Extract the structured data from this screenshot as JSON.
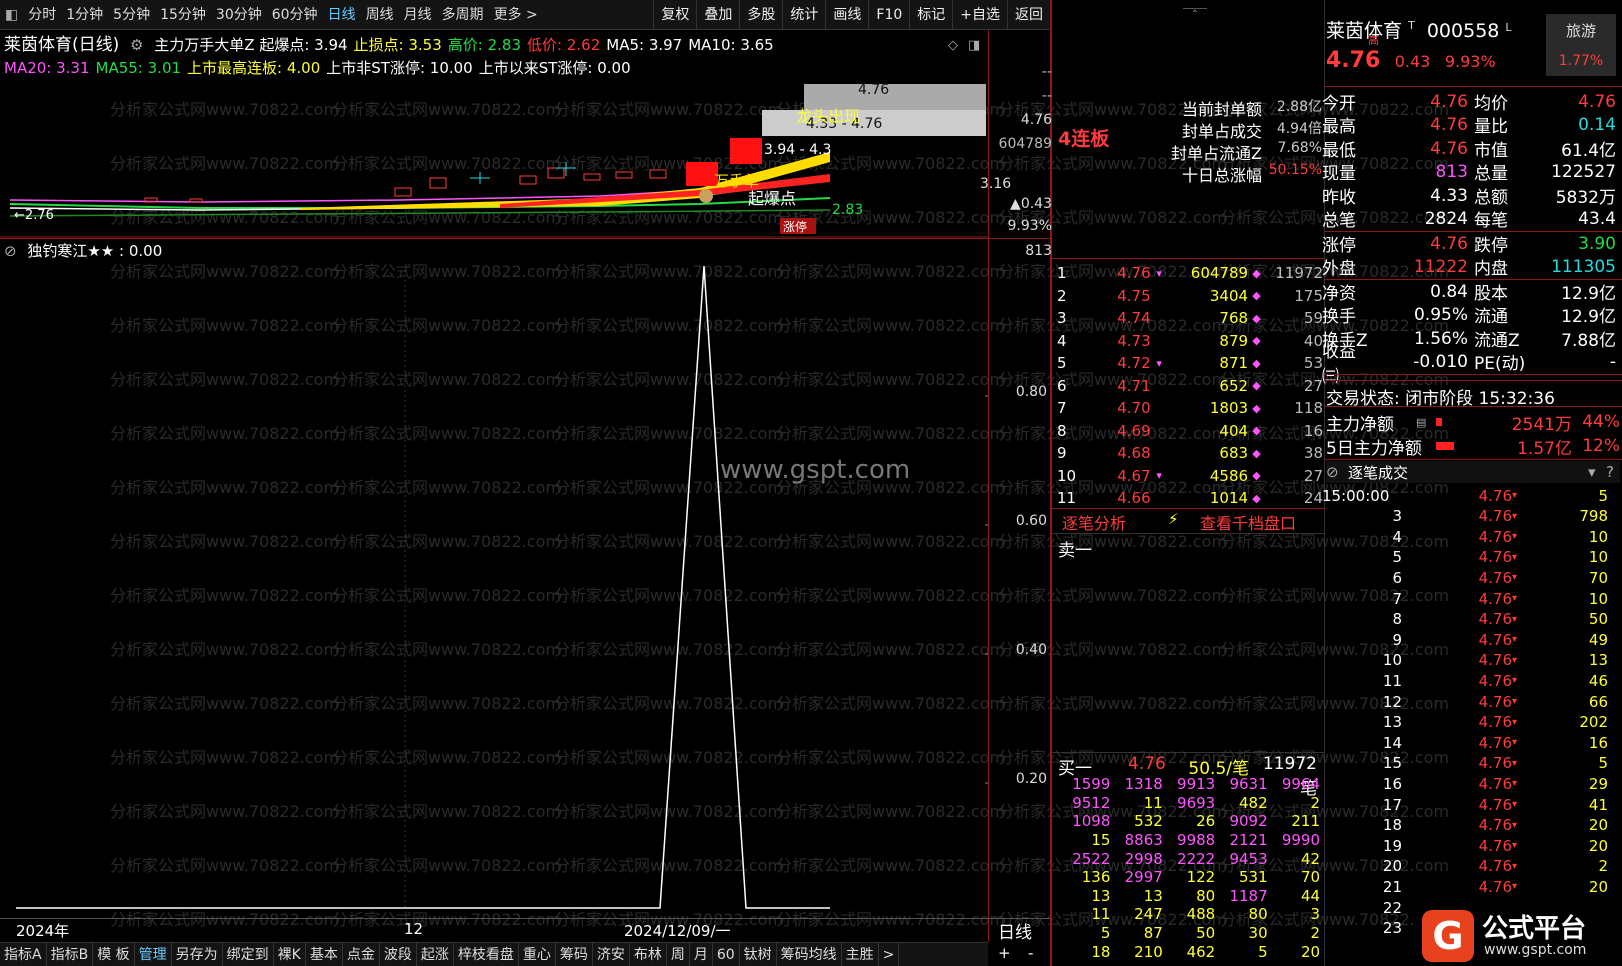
{
  "topbar": {
    "periods": [
      "分时",
      "1分钟",
      "5分钟",
      "15分钟",
      "30分钟",
      "60分钟",
      "日线",
      "周线",
      "月线",
      "多周期",
      "更多 >"
    ],
    "active_period": "日线",
    "tools": [
      "复权",
      "叠加",
      "多股",
      "统计",
      "画线",
      "F10",
      "标记",
      "+自选",
      "返回"
    ]
  },
  "chart_header": {
    "title": "莱茵体育(日线)",
    "line1": [
      {
        "text": "主力万手大单Z 起爆点: 3.94",
        "color": "#ffffff"
      },
      {
        "text": "止损点: 3.53",
        "color": "#ffff33"
      },
      {
        "text": "高价: 2.83",
        "color": "#22dd44"
      },
      {
        "text": "低价: 2.62",
        "color": "#ff3b3b"
      },
      {
        "text": "MA5: 3.97",
        "color": "#ffffff"
      },
      {
        "text": "MA10: 3.65",
        "color": "#ffffff"
      }
    ],
    "line2": [
      {
        "text": "MA20: 3.31",
        "color": "#ff55ff"
      },
      {
        "text": "MA55: 3.01",
        "color": "#22dd44"
      },
      {
        "text": "上市最高连板: 4.00",
        "color": "#ffff33"
      },
      {
        "text": "上市非ST涨停: 10.00",
        "color": "#ffffff"
      },
      {
        "text": "上市以来ST涨停: 0.00",
        "color": "#ffffff"
      }
    ]
  },
  "kline": {
    "labels": {
      "high_marker": "4.76",
      "range_box": "4.33 - 4.76",
      "mid_marker": "3.94 - 4.3",
      "dragon_text": "龙头出现",
      "main_force_text": "万手单",
      "burst_text": "起爆点",
      "low_marker": "2.83",
      "left_marker": "←2.76",
      "limit_tag": "涨停"
    },
    "axis": {
      "top": "--",
      "second": "--",
      "price_high": "4.76",
      "volume": "604789",
      "price_low": "3.16",
      "change": "▲0.43",
      "change_pct": "9.93%"
    }
  },
  "indicator": {
    "title": "独钓寒江★★ : 0.00",
    "axis_top": "813",
    "ticks": [
      "0.80",
      "0.60",
      "0.40",
      "0.20"
    ],
    "watermark": "www.gspt.com"
  },
  "xaxis": {
    "labels": [
      "2024年",
      "12",
      "2024/12/09/一"
    ],
    "period_label": "日线",
    "controls": [
      "+",
      "-"
    ]
  },
  "bottombar": [
    "指标A",
    "指标B",
    "模 板",
    "管理",
    "另存为",
    "绑定到",
    "裸K",
    "基本",
    "点金",
    "波段",
    "起涨",
    "梓枝看盘",
    "重心",
    "筹码",
    "济安",
    "布林",
    "周",
    "月",
    "60",
    "钛树",
    "筹码均线",
    "主胜",
    ">"
  ],
  "bottombar_active": "管理",
  "seal": {
    "lianban": "4连板",
    "rows": [
      {
        "label": "当前封单额",
        "value": "2.88亿"
      },
      {
        "label": "封单占成交",
        "value": "4.94倍"
      },
      {
        "label": "封单占流通Z",
        "value": "7.68%"
      },
      {
        "label": "十日总涨幅",
        "value": "50.15%"
      }
    ]
  },
  "orderbook": [
    {
      "n": "1",
      "p": "4.76",
      "v": "604789",
      "c": "11972",
      "flag": true
    },
    {
      "n": "2",
      "p": "4.75",
      "v": "3404",
      "c": "175",
      "flag": false
    },
    {
      "n": "3",
      "p": "4.74",
      "v": "768",
      "c": "59",
      "flag": false
    },
    {
      "n": "4",
      "p": "4.73",
      "v": "879",
      "c": "40",
      "flag": false
    },
    {
      "n": "5",
      "p": "4.72",
      "v": "871",
      "c": "53",
      "flag": true
    },
    {
      "n": "6",
      "p": "4.71",
      "v": "652",
      "c": "27",
      "flag": false
    },
    {
      "n": "7",
      "p": "4.70",
      "v": "1803",
      "c": "118",
      "flag": false
    },
    {
      "n": "8",
      "p": "4.69",
      "v": "404",
      "c": "16",
      "flag": false
    },
    {
      "n": "9",
      "p": "4.68",
      "v": "683",
      "c": "38",
      "flag": false
    },
    {
      "n": "10",
      "p": "4.67",
      "v": "4586",
      "c": "27",
      "flag": true
    },
    {
      "n": "11",
      "p": "4.66",
      "v": "1014",
      "c": "24",
      "flag": false
    }
  ],
  "mid_tabs": {
    "tick_analysis": "逐笔分析",
    "view_book": "查看千档盘口",
    "sell1": "卖一"
  },
  "buy1": {
    "label": "买一",
    "price": "4.76",
    "per": "50.5/笔",
    "count": "11972笔"
  },
  "buy_queue": [
    [
      "1599",
      "1318",
      "9913",
      "9631",
      "9964"
    ],
    [
      "9512",
      "11",
      "9693",
      "482",
      "2"
    ],
    [
      "1098",
      "532",
      "26",
      "9092",
      "211"
    ],
    [
      "15",
      "8863",
      "9988",
      "2121",
      "9990"
    ],
    [
      "2522",
      "2998",
      "2222",
      "9453",
      "42"
    ],
    [
      "136",
      "2997",
      "122",
      "531",
      "70"
    ],
    [
      "13",
      "13",
      "80",
      "1187",
      "44"
    ],
    [
      "11",
      "247",
      "488",
      "80",
      "3"
    ],
    [
      "5",
      "87",
      "50",
      "30",
      "2"
    ],
    [
      "18",
      "210",
      "462",
      "5",
      "20"
    ]
  ],
  "quote": {
    "name": "莱茵体育",
    "name_tags": [
      "T",
      "高"
    ],
    "code": "000558",
    "code_tag": "L",
    "badge": "旅游",
    "badge_pct": "1.77%",
    "price": "4.76",
    "change": "0.43",
    "pct": "9.93%",
    "rows": [
      {
        "l": "今开",
        "lv": "4.76",
        "lc": "#ff3b3b",
        "r": "均价",
        "rv": "4.76",
        "rc": "#ff3b3b",
        "box": true
      },
      {
        "l": "最高",
        "lv": "4.76",
        "lc": "#ff3b3b",
        "r": "量比",
        "rv": "0.14",
        "rc": "#22dddd",
        "box": true
      },
      {
        "l": "最低",
        "lv": "4.76",
        "lc": "#ff3b3b",
        "r": "市值",
        "rv": "61.4亿",
        "rc": "#ffffff",
        "box": false
      },
      {
        "l": "现量",
        "lv": "813",
        "lc": "#ff55ff",
        "r": "总量",
        "rv": "122527",
        "rc": "#ffffff",
        "box": false
      },
      {
        "l": "昨收",
        "lv": "4.33",
        "lc": "#ffffff",
        "r": "总额",
        "rv": "5832万",
        "rc": "#ffffff",
        "box": false
      },
      {
        "l": "总笔",
        "lv": "2824",
        "lc": "#ffffff",
        "r": "每笔",
        "rv": "43.4",
        "rc": "#ffffff",
        "box": false
      },
      {
        "l": "涨停",
        "lv": "4.76",
        "lc": "#ff3b3b",
        "r": "跌停",
        "rv": "3.90",
        "rc": "#22dd44",
        "box": false
      },
      {
        "l": "外盘",
        "lv": "11222",
        "lc": "#ff3b3b",
        "r": "内盘",
        "rv": "111305",
        "rc": "#22dddd",
        "box": false
      },
      {
        "l": "净资",
        "lv": "0.84",
        "lc": "#ffffff",
        "r": "股本",
        "rv": "12.9亿",
        "rc": "#ffffff",
        "box": false
      },
      {
        "l": "换手",
        "lv": "0.95%",
        "lc": "#ffffff",
        "r": "流通",
        "rv": "12.9亿",
        "rc": "#ffffff",
        "box": false
      },
      {
        "l": "换手Z",
        "lv": "1.56%",
        "lc": "#ffffff",
        "r": "流通Z",
        "rv": "7.88亿",
        "rc": "#ffffff",
        "box": false
      },
      {
        "l": "收益㈢",
        "lv": "-0.010",
        "lc": "#ffffff",
        "r": "PE(动)",
        "rv": "-",
        "rc": "#ffffff",
        "box": false
      }
    ],
    "trade_status": "交易状态: 闭市阶段 15:32:36",
    "main_net": {
      "label": "主力净额",
      "value": "2541万",
      "pct": "44%",
      "fill": 0.1
    },
    "main_net5": {
      "label": "5日主力净额",
      "value": "1.57亿",
      "pct": "12%",
      "fill": 0.3
    }
  },
  "ticks_header": "逐笔成交",
  "ticks": [
    {
      "t": "15:00:00",
      "p": "4.76",
      "v": "5"
    },
    {
      "t": "3",
      "p": "4.76",
      "v": "798"
    },
    {
      "t": "4",
      "p": "4.76",
      "v": "10"
    },
    {
      "t": "5",
      "p": "4.76",
      "v": "10"
    },
    {
      "t": "6",
      "p": "4.76",
      "v": "70"
    },
    {
      "t": "7",
      "p": "4.76",
      "v": "10"
    },
    {
      "t": "8",
      "p": "4.76",
      "v": "50"
    },
    {
      "t": "9",
      "p": "4.76",
      "v": "49"
    },
    {
      "t": "10",
      "p": "4.76",
      "v": "13"
    },
    {
      "t": "11",
      "p": "4.76",
      "v": "46"
    },
    {
      "t": "12",
      "p": "4.76",
      "v": "66"
    },
    {
      "t": "13",
      "p": "4.76",
      "v": "202"
    },
    {
      "t": "14",
      "p": "4.76",
      "v": "16"
    },
    {
      "t": "15",
      "p": "4.76",
      "v": "5"
    },
    {
      "t": "16",
      "p": "4.76",
      "v": "29"
    },
    {
      "t": "17",
      "p": "4.76",
      "v": "41"
    },
    {
      "t": "18",
      "p": "4.76",
      "v": "20"
    },
    {
      "t": "19",
      "p": "4.76",
      "v": "20"
    },
    {
      "t": "20",
      "p": "4.76",
      "v": "2"
    },
    {
      "t": "21",
      "p": "4.76",
      "v": "20"
    },
    {
      "t": "22",
      "p": "",
      "v": ""
    },
    {
      "t": "23",
      "p": "",
      "v": ""
    }
  ],
  "logo": {
    "title": "公式平台",
    "url": "www.gspt.com",
    "glyph": "G"
  },
  "watermark_text": "分析家公式网www.70822.com",
  "colors": {
    "up": "#ff3b3b",
    "down": "#22dd44",
    "volume": "#ffff33",
    "bg": "#000000",
    "divider": "#8a1a1a"
  }
}
